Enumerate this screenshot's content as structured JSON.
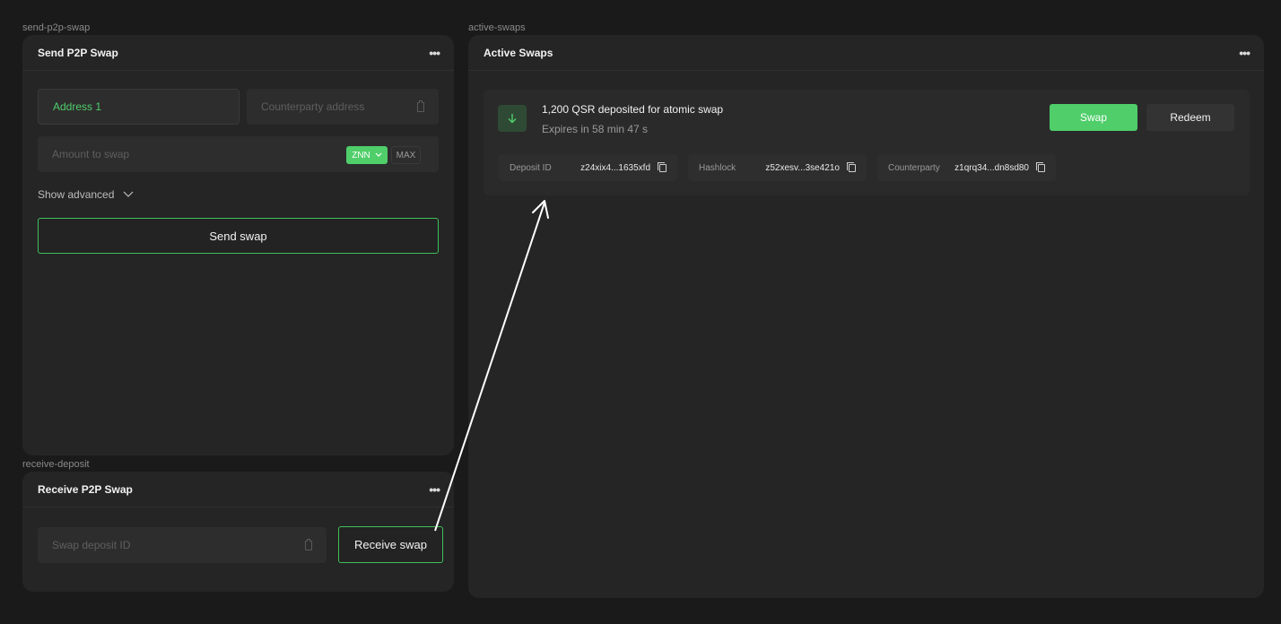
{
  "labels": {
    "send": "send-p2p-swap",
    "active": "active-swaps",
    "receive": "receive-deposit"
  },
  "send_panel": {
    "title": "Send P2P Swap",
    "address_value": "Address 1",
    "counterparty_placeholder": "Counterparty address",
    "amount_placeholder": "Amount to swap",
    "token": "ZNN",
    "max_label": "MAX",
    "show_advanced": "Show advanced",
    "send_button": "Send swap"
  },
  "receive_panel": {
    "title": "Receive P2P Swap",
    "deposit_placeholder": "Swap deposit ID",
    "receive_button": "Receive swap"
  },
  "active_panel": {
    "title": "Active Swaps",
    "swap": {
      "title": "1,200 QSR deposited for atomic swap",
      "subtitle": "Expires in 58 min 47 s",
      "swap_button": "Swap",
      "redeem_button": "Redeem",
      "deposit_id_label": "Deposit ID",
      "deposit_id_value": "z24xix4...1635xfd",
      "hashlock_label": "Hashlock",
      "hashlock_value": "z52xesv...3se421o",
      "counterparty_label": "Counterparty",
      "counterparty_value": "z1qrq34...dn8sd80"
    }
  },
  "colors": {
    "accent": "#4fce6a",
    "background": "#1a1a1a",
    "panel": "#252525"
  },
  "icons": [
    "more-dots-icon",
    "clipboard-icon",
    "chevron-down-icon",
    "arrow-down-icon",
    "copy-icon",
    "annotation-arrow"
  ]
}
